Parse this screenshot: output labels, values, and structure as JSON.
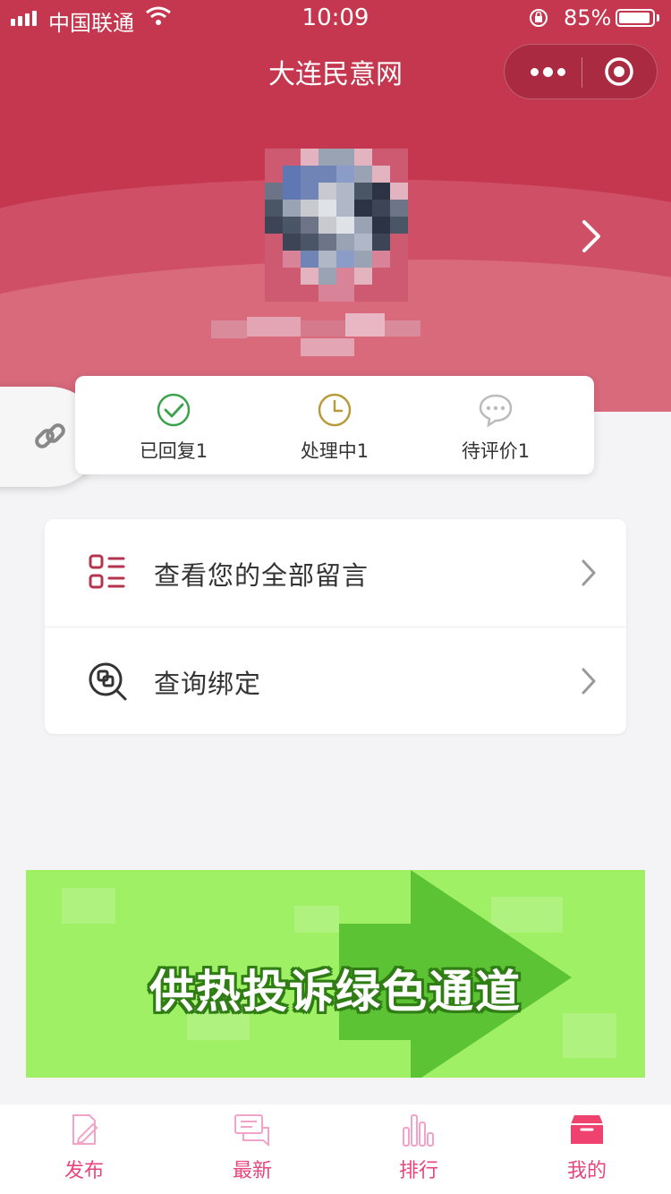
{
  "status_bar": {
    "carrier": "中国联通",
    "time": "10:09",
    "battery_percent": "85%"
  },
  "nav": {
    "title": "大连民意网"
  },
  "stats": [
    {
      "label": "已回复1",
      "icon": "check-circle-icon",
      "color": "#3aa24a"
    },
    {
      "label": "处理中1",
      "icon": "clock-icon",
      "color": "#b89a3a"
    },
    {
      "label": "待评价1",
      "icon": "chat-bubble-icon",
      "color": "#bbbbbb"
    }
  ],
  "menu": [
    {
      "label": "查看您的全部留言",
      "icon": "message-list-icon"
    },
    {
      "label": "查询绑定",
      "icon": "search-binding-icon"
    }
  ],
  "banner": {
    "text": "供热投诉绿色通道"
  },
  "tabbar": [
    {
      "label": "发布",
      "icon": "edit-icon",
      "active": false
    },
    {
      "label": "最新",
      "icon": "messages-icon",
      "active": false
    },
    {
      "label": "排行",
      "icon": "bar-chart-icon",
      "active": false
    },
    {
      "label": "我的",
      "icon": "inbox-icon",
      "active": true
    }
  ],
  "colors": {
    "header": "#c4374f",
    "accent": "#e8457d",
    "banner": "#9ff065"
  }
}
